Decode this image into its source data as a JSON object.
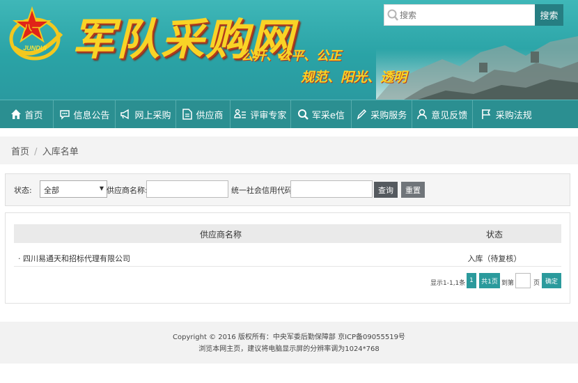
{
  "header": {
    "emblem_text": "JUNDUI",
    "site_title": "军队采购网",
    "slogan_line1": "公开、公平、公正",
    "slogan_line2": "规范、阳光、透明"
  },
  "search": {
    "placeholder": "搜索",
    "button_label": "搜索"
  },
  "nav": {
    "items": [
      {
        "label": "首页",
        "icon": "home-icon"
      },
      {
        "label": "信息公告",
        "icon": "speech-bubble-icon"
      },
      {
        "label": "网上采购",
        "icon": "megaphone-icon"
      },
      {
        "label": "供应商",
        "icon": "document-icon"
      },
      {
        "label": "评审专家",
        "icon": "person-list-icon"
      },
      {
        "label": "军采e信",
        "icon": "search-icon"
      },
      {
        "label": "采购服务",
        "icon": "pen-icon"
      },
      {
        "label": "意见反馈",
        "icon": "person-icon"
      },
      {
        "label": "采购法规",
        "icon": "flag-icon"
      }
    ]
  },
  "breadcrumb": {
    "home": "首页",
    "separator": "/",
    "current": "入库名单"
  },
  "filter": {
    "status_label": "状态:",
    "status_value": "全部",
    "supplier_name_label": "供应商名称:",
    "credit_code_label": "统一社会信用代码:",
    "query_button": "查询",
    "reset_button": "重置"
  },
  "table": {
    "columns": [
      "供应商名称",
      "状态"
    ],
    "rows": [
      {
        "name": "四川易通天和招标代理有限公司",
        "status": "入库（待复核）"
      }
    ]
  },
  "pagination": {
    "info": "显示1-1,1条",
    "current_page": "1",
    "total_pages": "共1页",
    "goto_label": "到第",
    "page_unit": "页",
    "confirm_button": "确定"
  },
  "footer": {
    "copyright": "Copyright © 2016 版权所有：中央军委后勤保障部 京ICP备09055519号",
    "resolution_note": "浏览本网主页，建议将电脑显示屏的分辨率调为1024*768"
  },
  "colors": {
    "banner": "#2aa3a6",
    "nav": "#2b8f91",
    "title_gold": "#f9d326",
    "button_teal": "#2b9a9c"
  }
}
